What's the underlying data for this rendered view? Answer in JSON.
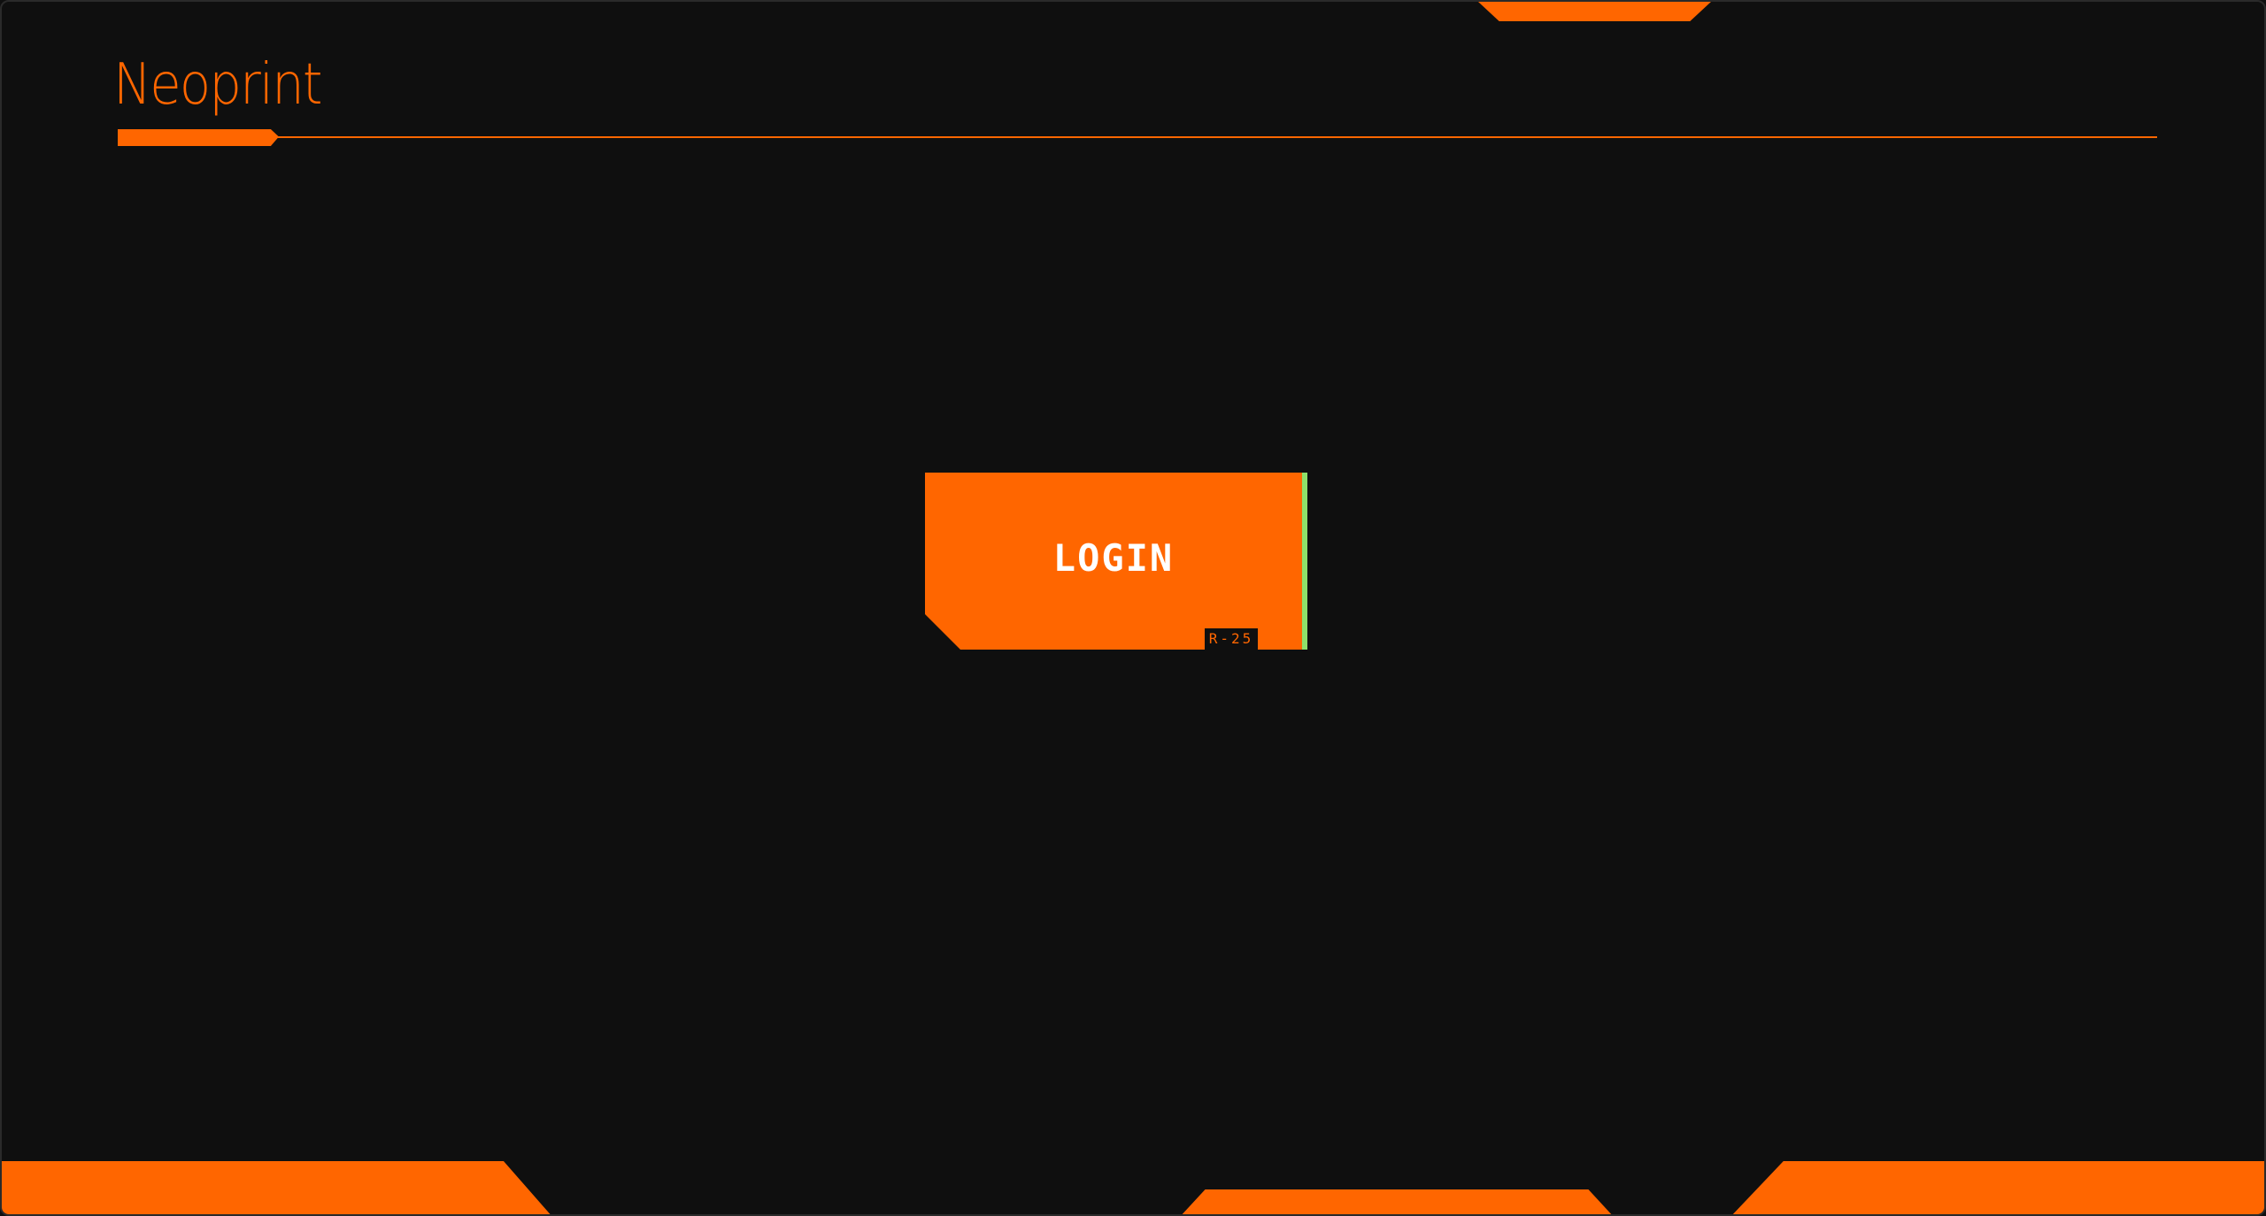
{
  "app": {
    "title": "Neoprint"
  },
  "login": {
    "label": "LOGIN",
    "tag": "R-25"
  },
  "colors": {
    "background": "#0f0f0f",
    "accent": "#ff6600",
    "success_accent": "#8ee06a",
    "text_on_accent": "#ffffff"
  }
}
